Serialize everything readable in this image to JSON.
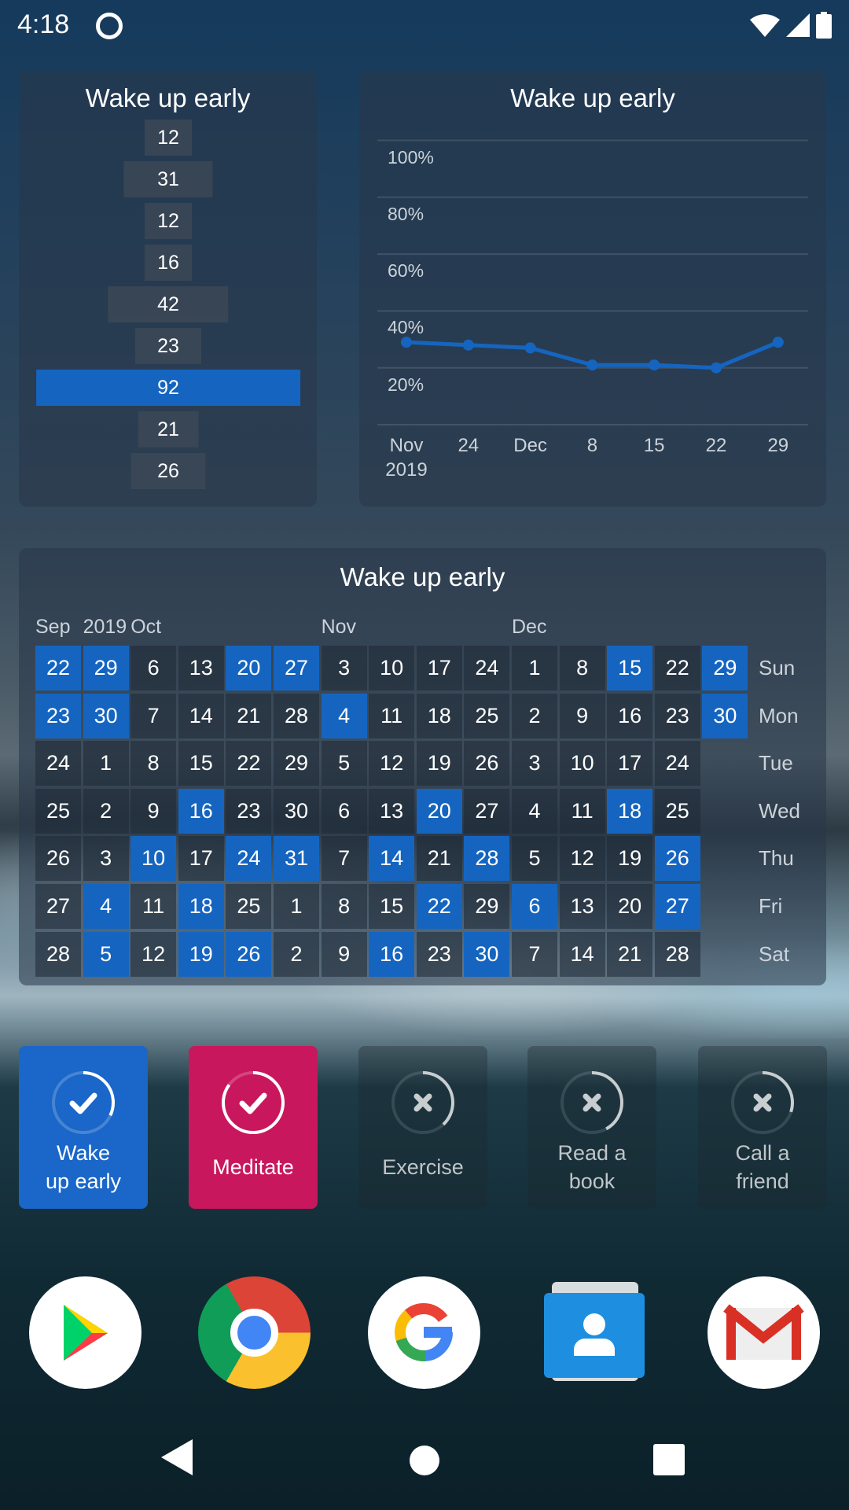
{
  "status_bar": {
    "time": "4:18",
    "icons": [
      "q-notification-icon",
      "wifi-icon",
      "signal-icon",
      "battery-icon"
    ]
  },
  "score_widget": {
    "title": "Wake up early",
    "values": [
      12,
      31,
      12,
      16,
      42,
      23,
      92,
      21,
      26
    ],
    "highlight_index": 6
  },
  "chart_data": {
    "type": "line",
    "title": "Wake up early",
    "x": [
      "Nov 17 2019",
      "Nov 24",
      "Dec 1",
      "Dec 8",
      "Dec 15",
      "Dec 22",
      "Dec 29"
    ],
    "xtick_labels": [
      "Nov",
      "24",
      "Dec",
      "8",
      "15",
      "22",
      "29"
    ],
    "xtick_sublabel": "2019",
    "values": [
      29,
      28,
      27,
      21,
      21,
      20,
      29
    ],
    "ytick_labels": [
      "100%",
      "80%",
      "60%",
      "40%",
      "20%"
    ],
    "ylim": [
      0,
      100
    ],
    "grid": true,
    "color": "#1565c0"
  },
  "calendar": {
    "title": "Wake up early",
    "months": [
      {
        "label": "Sep",
        "col": 0
      },
      {
        "label": "2019",
        "col": 1
      },
      {
        "label": "Oct",
        "col": 2
      },
      {
        "label": "Nov",
        "col": 6
      },
      {
        "label": "Dec",
        "col": 10
      }
    ],
    "weekdays": [
      "Sun",
      "Mon",
      "Tue",
      "Wed",
      "Thu",
      "Fri",
      "Sat"
    ],
    "weeks": [
      {
        "days": [
          22,
          23,
          24,
          25,
          26,
          27,
          28
        ],
        "done": [
          0,
          1
        ]
      },
      {
        "days": [
          29,
          30,
          1,
          2,
          3,
          4,
          5
        ],
        "done": [
          0,
          1,
          5,
          6
        ]
      },
      {
        "days": [
          6,
          7,
          8,
          9,
          10,
          11,
          12
        ],
        "done": [
          4
        ]
      },
      {
        "days": [
          13,
          14,
          15,
          16,
          17,
          18,
          19
        ],
        "done": [
          3,
          5,
          6
        ]
      },
      {
        "days": [
          20,
          21,
          22,
          23,
          24,
          25,
          26
        ],
        "done": [
          0,
          4,
          6
        ]
      },
      {
        "days": [
          27,
          28,
          29,
          30,
          31,
          1,
          2
        ],
        "done": [
          0,
          4
        ]
      },
      {
        "days": [
          3,
          4,
          5,
          6,
          7,
          8,
          9
        ],
        "done": [
          1
        ]
      },
      {
        "days": [
          10,
          11,
          12,
          13,
          14,
          15,
          16
        ],
        "done": [
          4,
          6
        ]
      },
      {
        "days": [
          17,
          18,
          19,
          20,
          21,
          22,
          23
        ],
        "done": [
          3,
          5
        ]
      },
      {
        "days": [
          24,
          25,
          26,
          27,
          28,
          29,
          30
        ],
        "done": [
          4,
          6
        ]
      },
      {
        "days": [
          1,
          2,
          3,
          4,
          5,
          6,
          7
        ],
        "done": [
          5
        ]
      },
      {
        "days": [
          8,
          9,
          10,
          11,
          12,
          13,
          14
        ],
        "done": []
      },
      {
        "days": [
          15,
          16,
          17,
          18,
          19,
          20,
          21
        ],
        "done": [
          0,
          3
        ]
      },
      {
        "days": [
          22,
          23,
          24,
          25,
          26,
          27,
          28
        ],
        "done": [
          4,
          5
        ]
      },
      {
        "days": [
          29,
          30
        ],
        "done": [
          0,
          1
        ]
      }
    ],
    "done_color": "#1565c0"
  },
  "habits": [
    {
      "name": "Wake up early",
      "checked": true,
      "progress": 0.32,
      "color": "#1a66c9"
    },
    {
      "name": "Meditate",
      "checked": true,
      "progress": 0.85,
      "color": "#c8175d"
    },
    {
      "name": "Exercise",
      "checked": false,
      "progress": 0.38
    },
    {
      "name": "Read a book",
      "checked": false,
      "progress": 0.42
    },
    {
      "name": "Call a friend",
      "checked": false,
      "progress": 0.3
    }
  ],
  "dock": [
    {
      "app": "Play Store",
      "icon": "play-store-icon"
    },
    {
      "app": "Chrome",
      "icon": "chrome-icon"
    },
    {
      "app": "Google",
      "icon": "google-icon"
    },
    {
      "app": "Contacts",
      "icon": "contacts-icon"
    },
    {
      "app": "Gmail",
      "icon": "gmail-icon"
    }
  ],
  "nav": [
    "back-icon",
    "home-icon",
    "recents-icon"
  ]
}
